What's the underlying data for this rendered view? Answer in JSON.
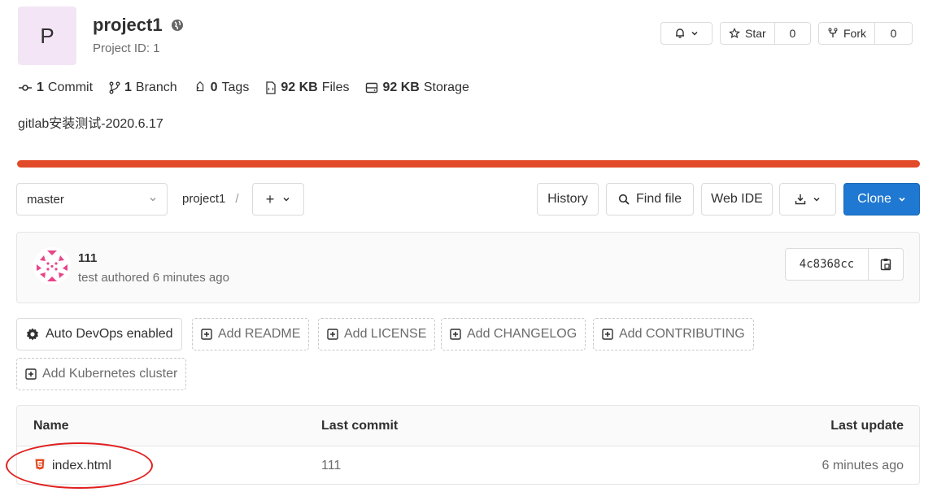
{
  "project": {
    "avatar_letter": "P",
    "name": "project1",
    "id_text": "Project ID: 1"
  },
  "actions": {
    "star_label": "Star",
    "star_count": "0",
    "fork_label": "Fork",
    "fork_count": "0"
  },
  "stats": [
    {
      "value": "1",
      "label": "Commit",
      "icon": "commit-icon"
    },
    {
      "value": "1",
      "label": "Branch",
      "icon": "branch-icon"
    },
    {
      "value": "0",
      "label": "Tags",
      "icon": "tag-icon"
    },
    {
      "value": "92 KB",
      "label": "Files",
      "icon": "file-icon"
    },
    {
      "value": "92 KB",
      "label": "Storage",
      "icon": "storage-icon"
    }
  ],
  "description": "gitlab安装测试-2020.6.17",
  "colors": {
    "progress_bar": "#e24b2a",
    "primary": "#1f78d1",
    "annotation": "#e02020"
  },
  "nav": {
    "branch": "master",
    "path_root": "project1",
    "path_sep": "/",
    "plus": "+",
    "history": "History",
    "find_file": "Find file",
    "web_ide": "Web IDE",
    "clone": "Clone"
  },
  "commit": {
    "title": "111",
    "meta": "test authored 6 minutes ago",
    "sha": "4c8368cc"
  },
  "quick_actions": {
    "auto_devops": "Auto DevOps enabled",
    "add_readme": "Add README",
    "add_license": "Add LICENSE",
    "add_changelog": "Add CHANGELOG",
    "add_contributing": "Add CONTRIBUTING",
    "add_k8s": "Add Kubernetes cluster"
  },
  "table": {
    "headers": {
      "name": "Name",
      "last_commit": "Last commit",
      "last_update": "Last update"
    },
    "rows": [
      {
        "name": "index.html",
        "last_commit": "111",
        "last_update": "6 minutes ago"
      }
    ]
  }
}
